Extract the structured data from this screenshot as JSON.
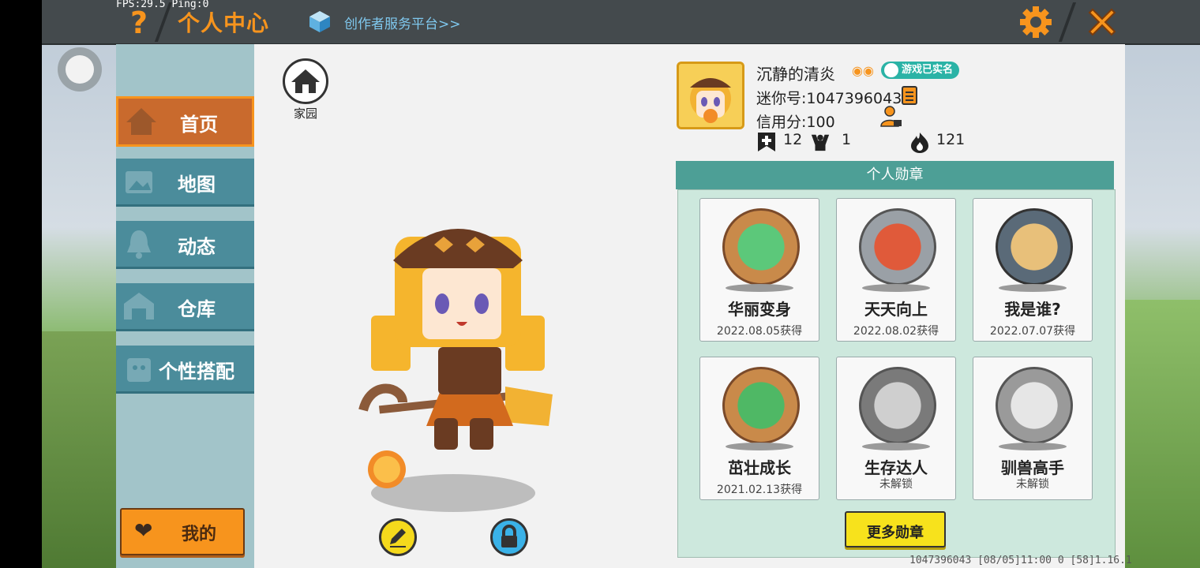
{
  "debug": {
    "fps": "FPS:29.5  Ping:0"
  },
  "header": {
    "help_icon": "question-icon",
    "title": "个人中心",
    "creator_link": "创作者服务平台>>"
  },
  "sidebar": {
    "items": [
      {
        "label": "首页",
        "icon": "house-icon",
        "active": true
      },
      {
        "label": "地图",
        "icon": "map-icon",
        "active": false
      },
      {
        "label": "动态",
        "icon": "bell-icon",
        "active": false
      },
      {
        "label": "仓库",
        "icon": "warehouse-icon",
        "active": false
      },
      {
        "label": "个性搭配",
        "icon": "outfit-icon",
        "active": false
      }
    ],
    "mine_label": "我的"
  },
  "home": {
    "label": "家园"
  },
  "profile": {
    "nickname": "沉静的清炎",
    "realname_badge": "游戏已实名",
    "uid": "迷你号:1047396043",
    "credit": "信用分:100",
    "stats": {
      "posts": "12",
      "fans": "1",
      "heat": "121"
    }
  },
  "badges": {
    "title": "个人勋章",
    "items": [
      {
        "name": "华丽变身",
        "date": "2022.08.05获得",
        "color": "#c98a4a"
      },
      {
        "name": "天天向上",
        "date": "2022.08.02获得",
        "color": "#9aa0a6"
      },
      {
        "name": "我是谁?",
        "date": "2022.07.07获得",
        "color": "#5a6a78"
      },
      {
        "name": "茁壮成长",
        "date": "2021.02.13获得",
        "color": "#c98a4a"
      },
      {
        "name": "生存达人",
        "date": "未解锁",
        "color": "#7a7a7a"
      },
      {
        "name": "驯兽高手",
        "date": "未解锁",
        "color": "#9a9a9a"
      }
    ],
    "more_label": "更多勋章"
  },
  "footer": {
    "info": "1047396043   [08/05]11:00 0  [58]1.16.1"
  },
  "colors": {
    "accent": "#f7941d",
    "nav": "#4b8c9b",
    "badge_header": "#4d9f96"
  }
}
